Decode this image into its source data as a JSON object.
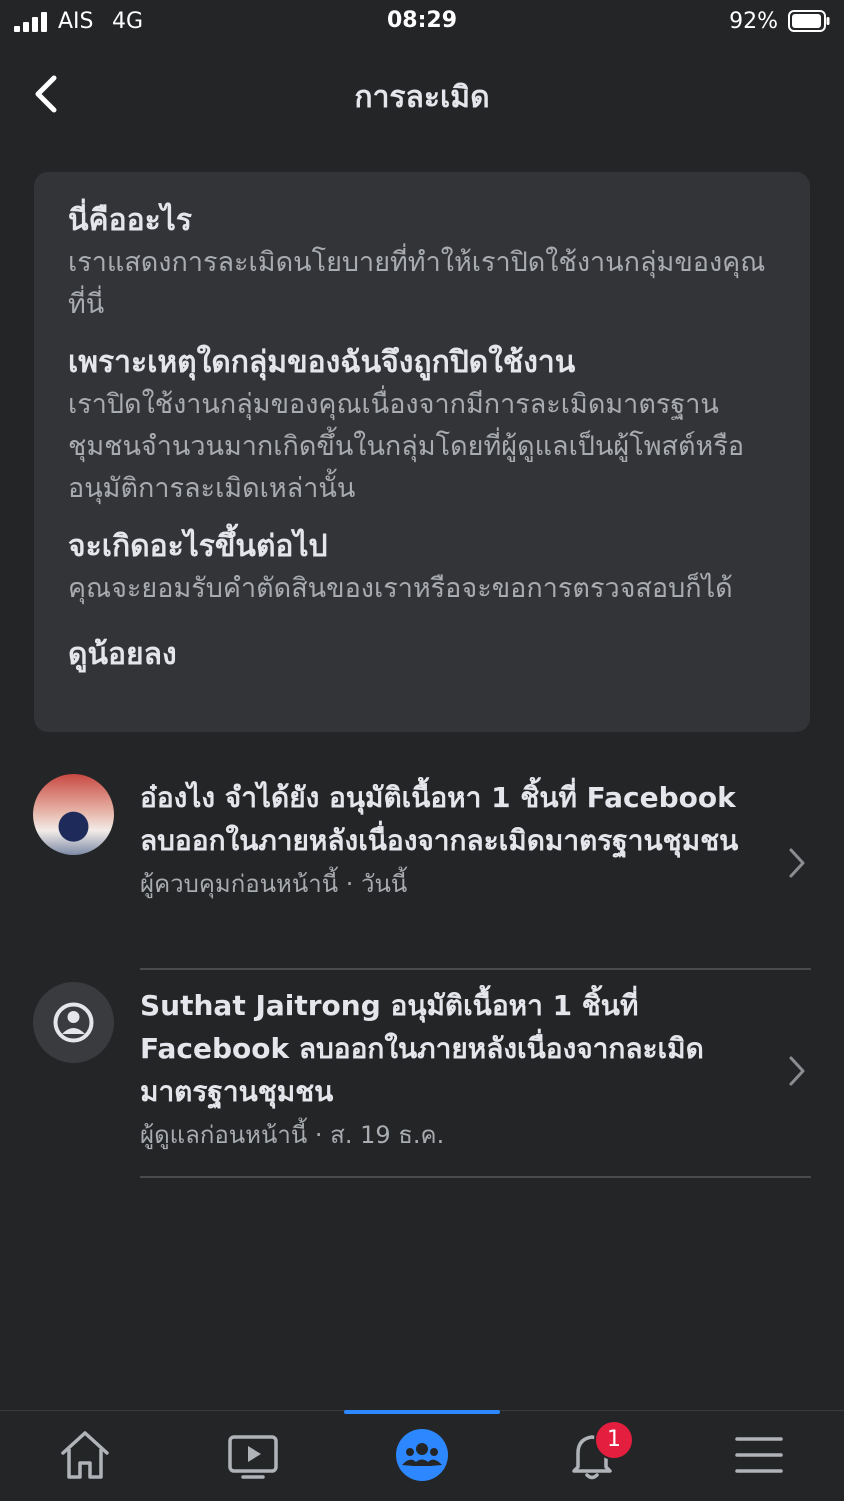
{
  "status_bar": {
    "carrier": "AIS",
    "network": "4G",
    "time": "08:29",
    "battery": "92%"
  },
  "header": {
    "title": "การละเมิด"
  },
  "info_card": {
    "sections": [
      {
        "title": "นี่คืออะไร",
        "body": "เราแสดงการละเมิดนโยบายที่ทำให้เราปิดใช้งานกลุ่มของคุณที่นี่"
      },
      {
        "title": "เพราะเหตุใดกลุ่มของฉันจึงถูกปิดใช้งาน",
        "body": "เราปิดใช้งานกลุ่มของคุณเนื่องจากมีการละเมิดมาตรฐานชุมชนจำนวนมากเกิดขึ้นในกลุ่มโดยที่ผู้ดูแลเป็นผู้โพสต์หรืออนุมัติการละเมิดเหล่านั้น"
      },
      {
        "title": "จะเกิดอะไรขึ้นต่อไป",
        "body": "คุณจะยอมรับคำตัดสินของเราหรือจะขอการตรวจสอบก็ได้"
      }
    ],
    "see_less": "ดูน้อยลง"
  },
  "violations": [
    {
      "title": "อ๋องไง จำได้ยัง อนุมัติเนื้อหา 1 ชิ้นที่ Facebook ลบออกในภายหลังเนื่องจากละเมิดมาตรฐานชุมชน",
      "meta": "ผู้ควบคุมก่อนหน้านี้ · วันนี้",
      "avatar": "photo"
    },
    {
      "title": "Suthat Jaitrong อนุมัติเนื้อหา 1 ชิ้นที่ Facebook ลบออกในภายหลังเนื่องจากละเมิดมาตรฐานชุมชน",
      "meta": "ผู้ดูแลก่อนหน้านี้  · ส. 19 ธ.ค.",
      "avatar": "default-profile-icon"
    }
  ],
  "tab_bar": {
    "tabs": [
      "home-icon",
      "video-icon",
      "groups-icon",
      "notifications-icon",
      "menu-icon"
    ],
    "active": "groups-icon",
    "notifications_badge": "1"
  },
  "colors": {
    "background": "#242527",
    "card": "#333437",
    "accent": "#2d88ff",
    "badge": "#e41e3f"
  }
}
